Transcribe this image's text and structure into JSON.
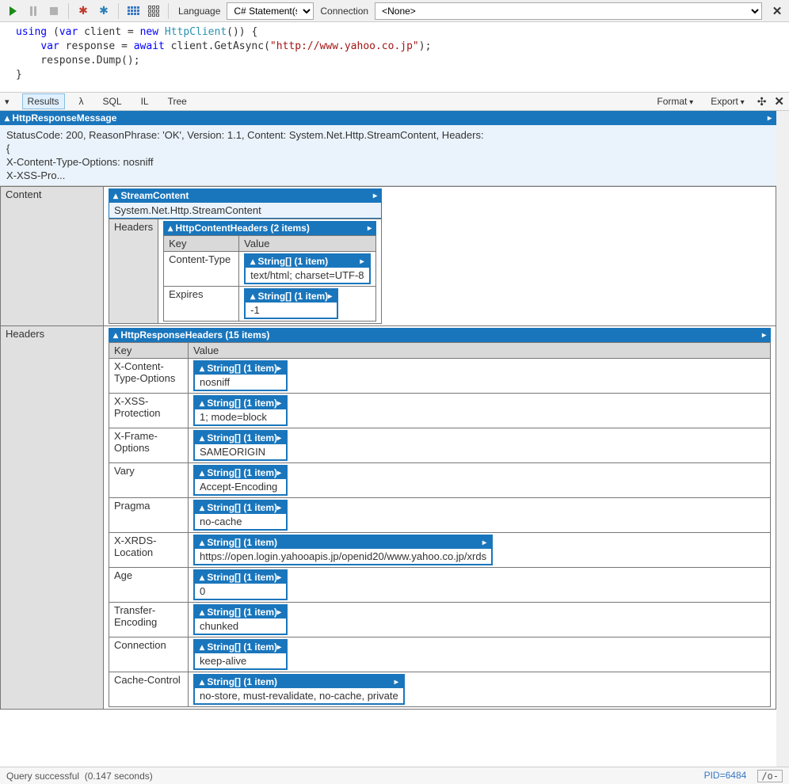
{
  "toolbar": {
    "language_label": "Language",
    "language_value": "C# Statement(s)",
    "connection_label": "Connection",
    "connection_value": "<None>"
  },
  "code": {
    "line1a": "using",
    "line1b": " (",
    "line1c": "var",
    "line1d": " client = ",
    "line1e": "new",
    "line1f": " ",
    "line1g": "HttpClient",
    "line1h": "()) {",
    "line2a": "    ",
    "line2b": "var",
    "line2c": " response = ",
    "line2d": "await",
    "line2e": " client.GetAsync(",
    "line2f": "\"http://www.yahoo.co.jp\"",
    "line2g": ");",
    "line3": "    response.Dump();",
    "line4": "}"
  },
  "tabs": {
    "results": "Results",
    "lambda": "λ",
    "sql": "SQL",
    "il": "IL",
    "tree": "Tree",
    "format": "Format",
    "export": "Export"
  },
  "dump": {
    "root_type": "HttpResponseMessage",
    "summary_l1": "StatusCode: 200, ReasonPhrase: 'OK', Version: 1.1, Content: System.Net.Http.StreamContent, Headers:",
    "summary_l2": "{",
    "summary_l3": "  X-Content-Type-Options: nosniff",
    "summary_l4": "  X-XSS-Pro...",
    "content_key": "Content",
    "stream_type": "StreamContent",
    "stream_caption": "System.Net.Http.StreamContent",
    "headers_key": "Headers",
    "content_headers_type": "HttpContentHeaders (2 items)",
    "col_key": "Key",
    "col_value": "Value",
    "string_one": "String[] (1 item)",
    "content_headers": [
      {
        "k": "Content-Type",
        "v": "text/html; charset=UTF-8"
      },
      {
        "k": "Expires",
        "v": "-1"
      }
    ],
    "response_headers_type": "HttpResponseHeaders (15 items)",
    "response_headers": [
      {
        "k": "X-Content-Type-Options",
        "v": "nosniff"
      },
      {
        "k": "X-XSS-Protection",
        "v": "1; mode=block"
      },
      {
        "k": "X-Frame-Options",
        "v": "SAMEORIGIN"
      },
      {
        "k": "Vary",
        "v": "Accept-Encoding"
      },
      {
        "k": "Pragma",
        "v": "no-cache"
      },
      {
        "k": "X-XRDS-Location",
        "v": "https://open.login.yahooapis.jp/openid20/www.yahoo.co.jp/xrds"
      },
      {
        "k": "Age",
        "v": "0"
      },
      {
        "k": "Transfer-Encoding",
        "v": "chunked"
      },
      {
        "k": "Connection",
        "v": "keep-alive"
      },
      {
        "k": "Cache-Control",
        "v": "no-store, must-revalidate, no-cache, private"
      }
    ]
  },
  "status": {
    "msg": "Query successful",
    "time": "(0.147 seconds)",
    "pid": "PID=6484",
    "end": "/o-"
  }
}
